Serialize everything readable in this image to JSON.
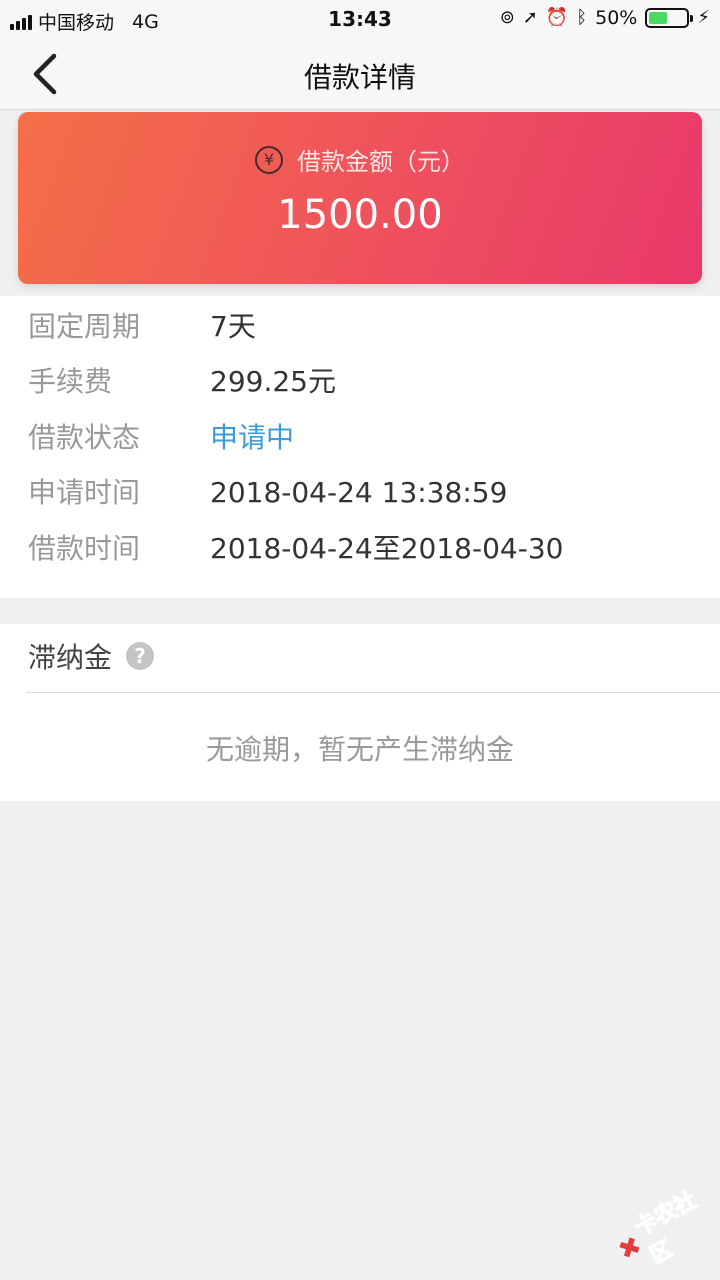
{
  "status_bar": {
    "carrier": "中国移动",
    "network": "4G",
    "time": "13:43",
    "battery_text": "50%",
    "battery_level": 0.5,
    "icons": [
      "lock-rotation-icon",
      "location-icon",
      "alarm-icon",
      "bluetooth-icon",
      "charging-icon"
    ]
  },
  "nav": {
    "title": "借款详情",
    "back_icon": "chevron-left-icon"
  },
  "amount_card": {
    "label": "借款金额（元）",
    "currency_symbol": "¥",
    "value": "1500.00",
    "colors": {
      "start": "#f46f47",
      "end": "#e8386a"
    }
  },
  "details": [
    {
      "label": "固定周期",
      "value": "7天"
    },
    {
      "label": "手续费",
      "value": "299.25元"
    },
    {
      "label": "借款状态",
      "value": "申请中",
      "color": "#3b9cdc"
    },
    {
      "label": "申请时间",
      "value": "2018-04-24 13:38:59"
    },
    {
      "label": "借款时间",
      "value": "2018-04-24至2018-04-30"
    }
  ],
  "late_fee": {
    "title": "滞纳金",
    "help_glyph": "?",
    "message": "无逾期，暂无产生滞纳金"
  },
  "watermark": {
    "text": "卡农社区"
  }
}
